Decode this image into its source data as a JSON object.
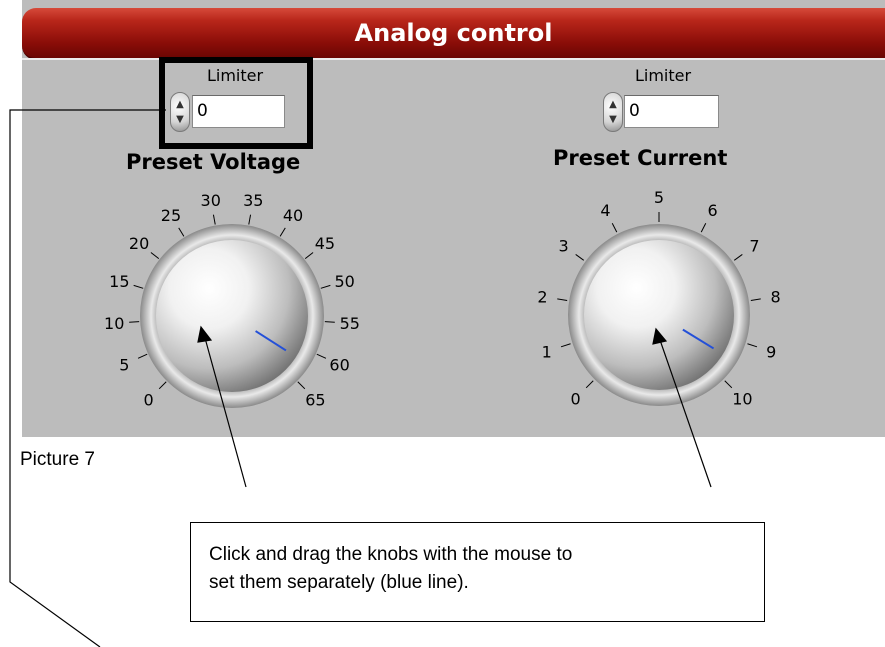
{
  "window": {
    "title": "Analog control"
  },
  "voltage": {
    "limiter_label": "Limiter",
    "limiter_value": "0",
    "preset_label": "Preset Voltage",
    "scale_labels": [
      "0",
      "5",
      "10",
      "15",
      "20",
      "25",
      "30",
      "35",
      "40",
      "45",
      "50",
      "55",
      "60",
      "65"
    ],
    "knob_value": 62
  },
  "current": {
    "limiter_label": "Limiter",
    "limiter_value": "0",
    "preset_label": "Preset Current",
    "scale_labels": [
      "0",
      "1",
      "2",
      "3",
      "4",
      "5",
      "6",
      "7",
      "8",
      "9",
      "10"
    ],
    "knob_value": 9.5
  },
  "annotations": {
    "caption": "Picture 7",
    "note_line1": "Click and drag the knobs with the mouse to",
    "note_line2": "set them separately  (blue line)."
  },
  "colors": {
    "panel_bg": "#bcbcbc",
    "title_red": "#8a0d08",
    "indicator_blue": "#2450d8"
  }
}
